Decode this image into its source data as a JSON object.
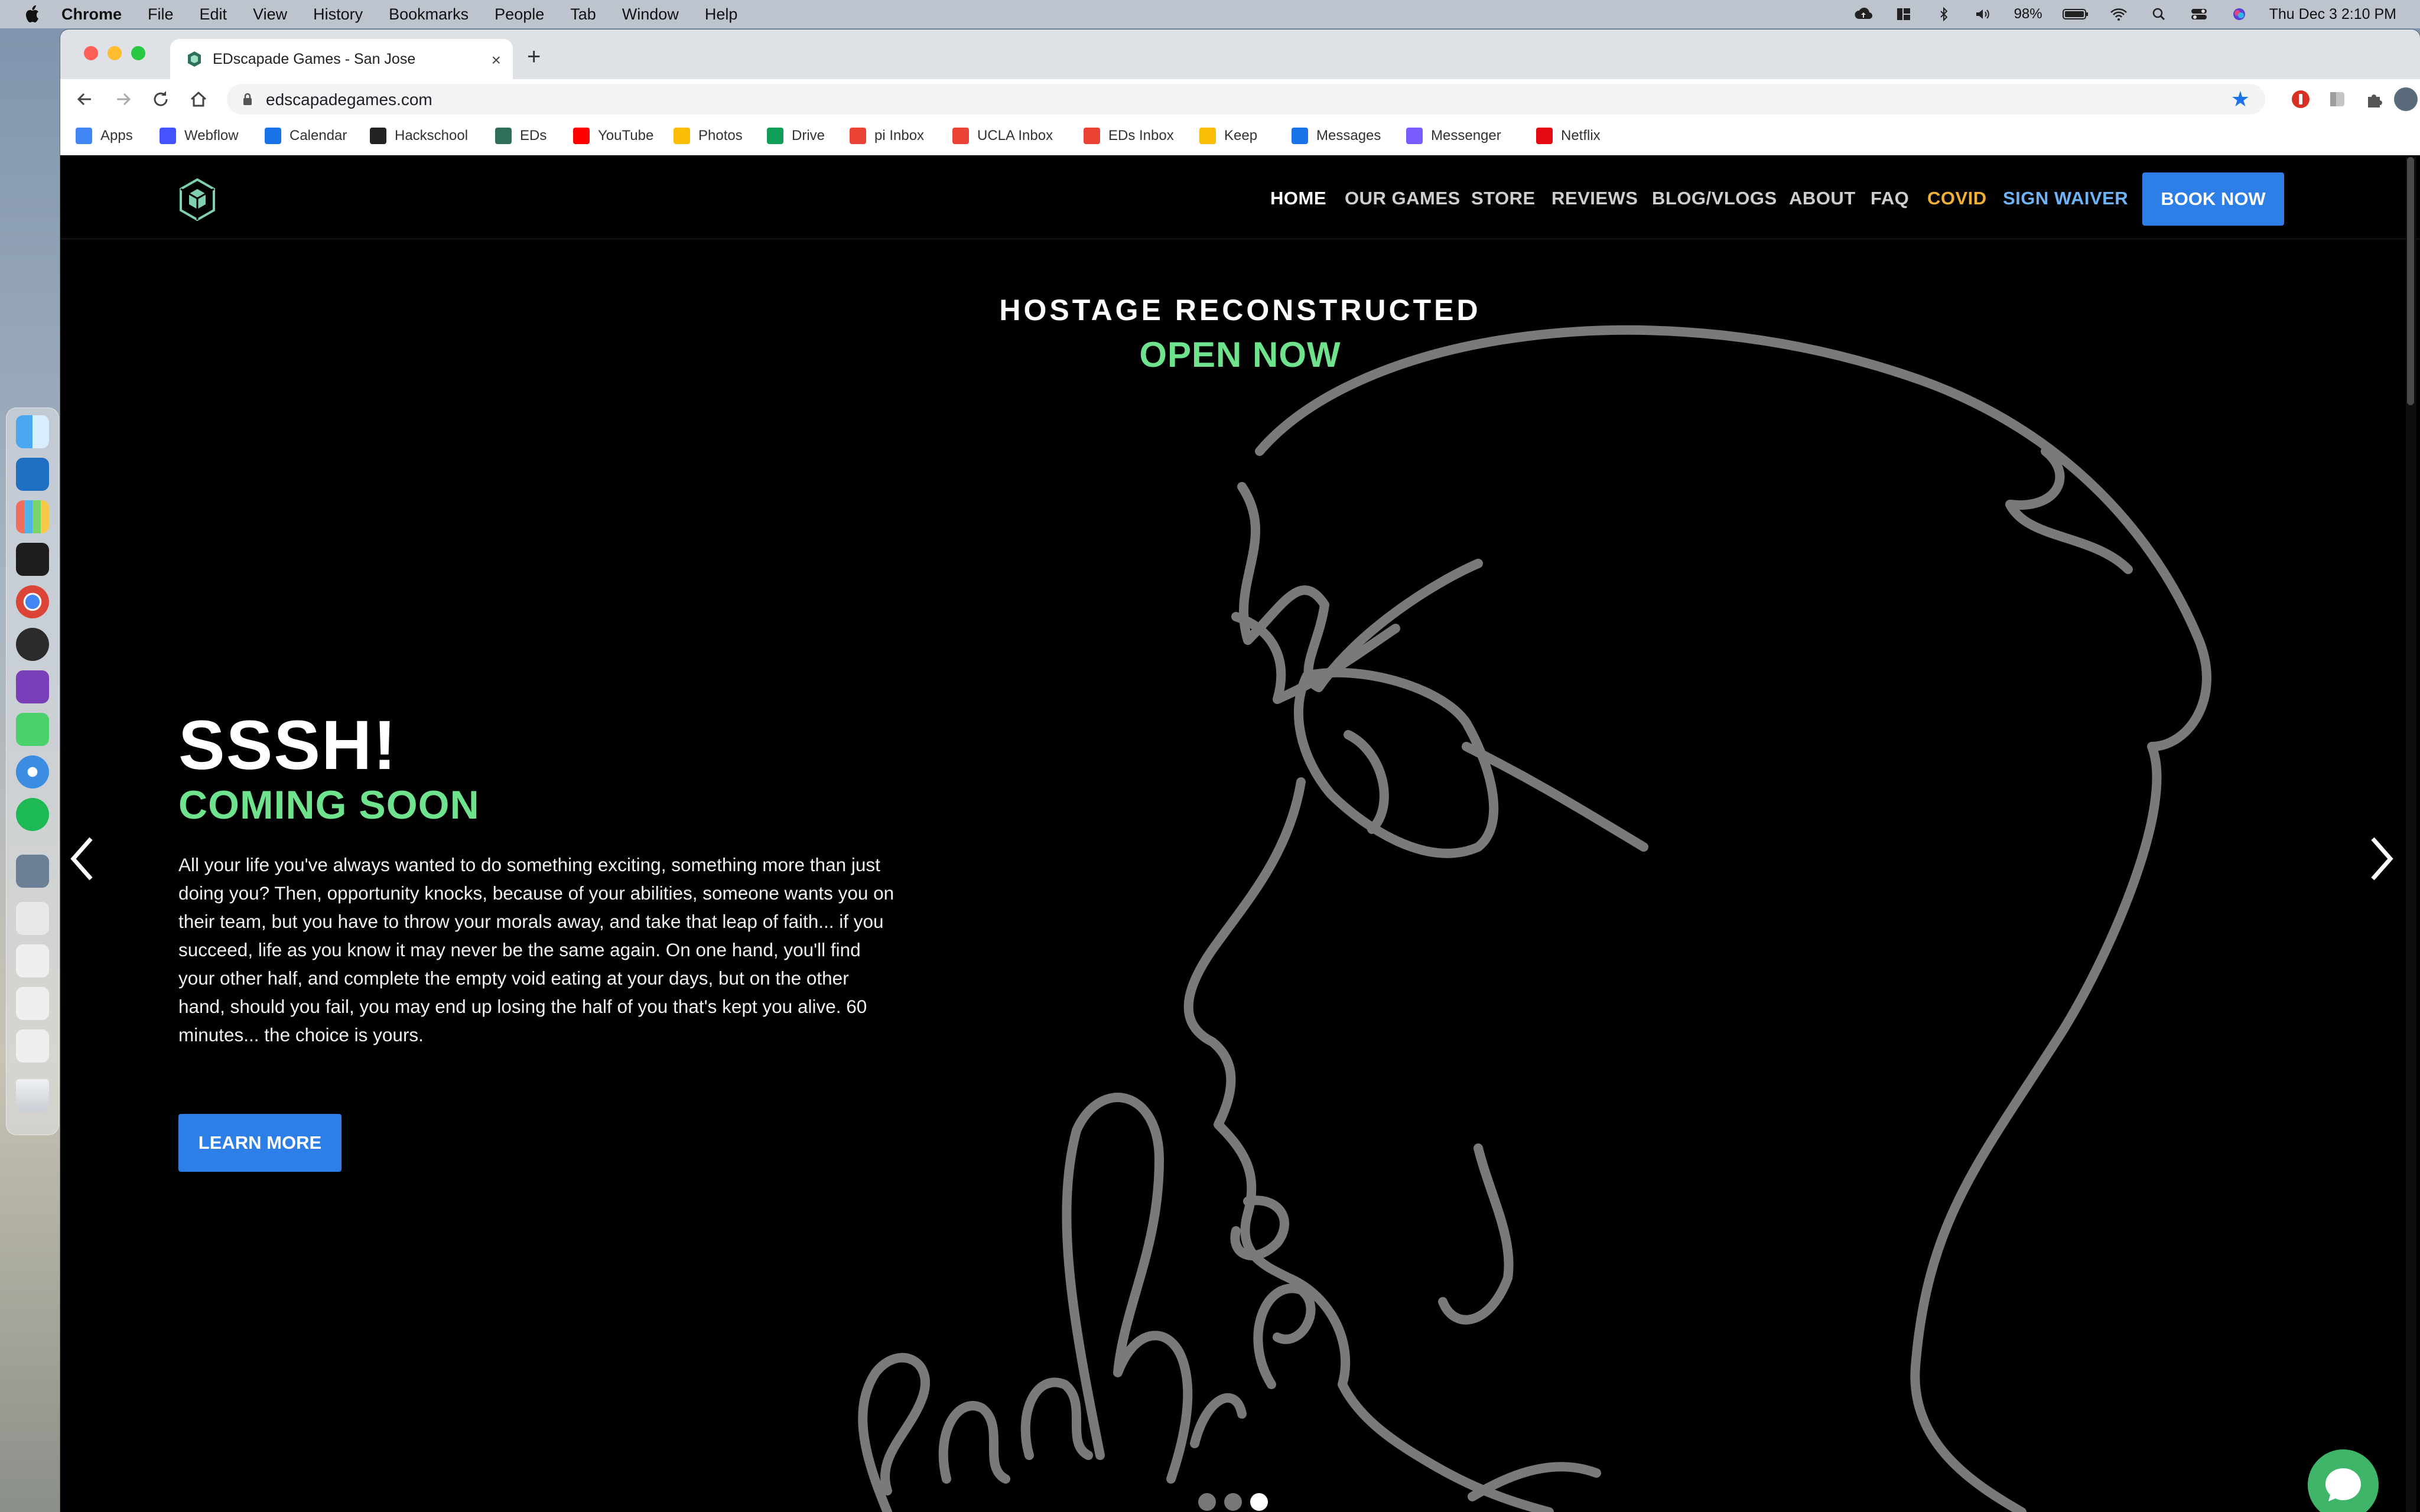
{
  "menubar": {
    "app": "Chrome",
    "items": [
      "File",
      "Edit",
      "View",
      "History",
      "Bookmarks",
      "People",
      "Tab",
      "Window",
      "Help"
    ],
    "battery": "98%",
    "clock": "Thu Dec 3  2:10 PM"
  },
  "browser": {
    "tab_title": "EDscapade Games - San Jose",
    "tab_close": "×",
    "new_tab": "+",
    "url": "edscapadegames.com",
    "star": "★"
  },
  "bookmarks": [
    {
      "label": "Apps",
      "icon": "apps-grid-icon",
      "color": "#4285f4"
    },
    {
      "label": "Webflow",
      "icon": "webflow-icon",
      "color": "#4353ff"
    },
    {
      "label": "Calendar",
      "icon": "calendar-icon",
      "color": "#1a73e8"
    },
    {
      "label": "Hackschool",
      "icon": "github-icon",
      "color": "#222222"
    },
    {
      "label": "EDs",
      "icon": "eds-logo-icon",
      "color": "#2f6f5a"
    },
    {
      "label": "YouTube",
      "icon": "youtube-icon",
      "color": "#ff0000"
    },
    {
      "label": "Photos",
      "icon": "photos-icon",
      "color": "#fbbc04"
    },
    {
      "label": "Drive",
      "icon": "drive-icon",
      "color": "#0f9d58"
    },
    {
      "label": "pi Inbox",
      "icon": "gmail-icon",
      "color": "#ea4335"
    },
    {
      "label": "UCLA Inbox",
      "icon": "gmail-icon",
      "color": "#ea4335"
    },
    {
      "label": "EDs Inbox",
      "icon": "gmail-icon",
      "color": "#ea4335"
    },
    {
      "label": "Keep",
      "icon": "keep-icon",
      "color": "#fbbc04"
    },
    {
      "label": "Messages",
      "icon": "messages-icon",
      "color": "#1a73e8"
    },
    {
      "label": "Messenger",
      "icon": "messenger-icon",
      "color": "#7b5cff"
    },
    {
      "label": "Netflix",
      "icon": "netflix-icon",
      "color": "#e50914"
    }
  ],
  "site": {
    "nav": {
      "home": "HOME",
      "games": "OUR GAMES",
      "store": "STORE",
      "reviews": "REVIEWS",
      "blog": "BLOG/VLOGS",
      "about": "ABOUT",
      "faq": "FAQ",
      "covid": "COVID",
      "waiver": "SIGN WAIVER",
      "book": "BOOK NOW"
    },
    "promo": {
      "title": "HOSTAGE RECONSTRUCTED",
      "subtitle": "OPEN NOW"
    },
    "slide": {
      "title": "SSSH!",
      "subtitle": "COMING SOON",
      "body": "All your life you've always wanted to do something exciting, something more than just doing you?  Then, opportunity knocks, because of your abilities, someone wants you on their team, but you have to throw your morals away, and take that leap of faith... if you succeed, life as you know it may never be the same again.  On one hand, you'll find your other half, and complete the empty void eating at your days, but on the other hand, should you fail, you may end up losing the half of you that's kept you alive.  60 minutes... the choice is yours.",
      "button": "LEARN MORE"
    },
    "carousel": {
      "slide_count": 3,
      "active_index": 3
    },
    "colors": {
      "accent_green": "#6ee28c",
      "button_blue": "#2d7ee6",
      "covid_orange": "#f2b136",
      "waiver_blue": "#6db3f5",
      "chat_green": "#3fb56a"
    }
  }
}
